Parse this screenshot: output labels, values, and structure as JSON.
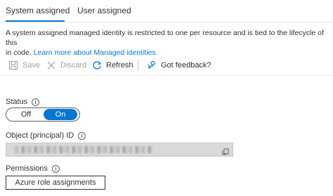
{
  "tabs": [
    {
      "label": "System assigned"
    },
    {
      "label": "User assigned"
    }
  ],
  "description": {
    "text": "A system assigned managed identity is restricted to one per resource and is tied to the lifecycle of this",
    "text2": "in code.",
    "link": "Learn more about Managed identities."
  },
  "toolbar": {
    "save_label": "Save",
    "discard_label": "Discard",
    "refresh_label": "Refresh",
    "feedback_label": "Got feedback?"
  },
  "status": {
    "label": "Status",
    "off_label": "Off",
    "on_label": "On"
  },
  "object_id": {
    "label": "Object (principal) ID"
  },
  "permissions": {
    "label": "Permissions",
    "button_label": "Azure role assignments"
  },
  "colors": {
    "accent": "#0078d4",
    "disabled_text": "#a19f9d"
  }
}
